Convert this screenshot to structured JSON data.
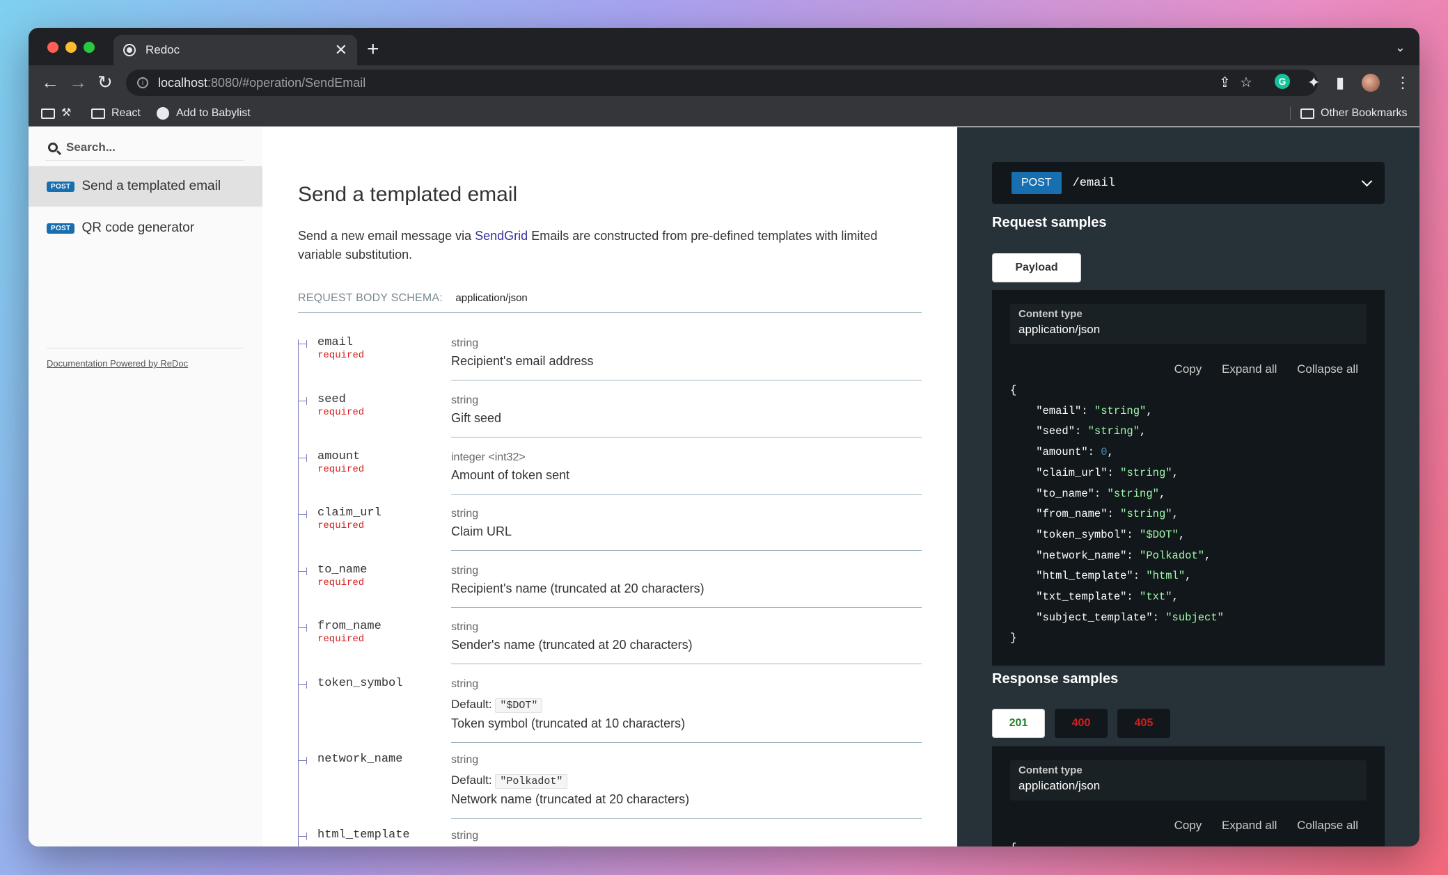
{
  "browser": {
    "tab_title": "Redoc",
    "url_host": "localhost",
    "url_path": ":8080/#operation/SendEmail",
    "bookmarks": [
      "React",
      "Add to Babylist"
    ],
    "other_bookmarks": "Other Bookmarks",
    "extension_g": "G"
  },
  "sidebar": {
    "search_placeholder": "Search...",
    "items": [
      {
        "badge": "POST",
        "label": "Send a templated email"
      },
      {
        "badge": "POST",
        "label": "QR code generator"
      }
    ],
    "powered_by": "Documentation Powered by ReDoc"
  },
  "main": {
    "title": "Send a templated email",
    "desc_prefix": "Send a new email message via ",
    "desc_link": "SendGrid",
    "desc_suffix": " Emails are constructed from pre-defined templates with limited variable substitution.",
    "schema_label": "REQUEST BODY SCHEMA:",
    "schema_content_type": "application/json",
    "props": [
      {
        "name": "email",
        "required": "required",
        "type": "string",
        "desc": "Recipient's email address"
      },
      {
        "name": "seed",
        "required": "required",
        "type": "string",
        "desc": "Gift seed"
      },
      {
        "name": "amount",
        "required": "required",
        "type": "integer <int32>",
        "desc": "Amount of token sent"
      },
      {
        "name": "claim_url",
        "required": "required",
        "type": "string",
        "desc": "Claim URL"
      },
      {
        "name": "to_name",
        "required": "required",
        "type": "string",
        "desc": "Recipient's name (truncated at 20 characters)"
      },
      {
        "name": "from_name",
        "required": "required",
        "type": "string",
        "desc": "Sender's name (truncated at 20 characters)"
      },
      {
        "name": "token_symbol",
        "type": "string",
        "default_label": "Default:",
        "default": "\"$DOT\"",
        "desc": "Token symbol (truncated at 10 characters)"
      },
      {
        "name": "network_name",
        "type": "string",
        "default_label": "Default:",
        "default": "\"Polkadot\"",
        "desc": "Network name (truncated at 20 characters)"
      },
      {
        "name": "html_template",
        "type": "string"
      }
    ]
  },
  "right": {
    "method": "POST",
    "path": "/email",
    "request_samples": "Request samples",
    "payload_tab": "Payload",
    "content_type_label": "Content type",
    "content_type": "application/json",
    "copy": "Copy",
    "expand_all": "Expand all",
    "collapse_all": "Collapse all",
    "json_open": "{",
    "json_close": "}",
    "json_lines": [
      {
        "k": "\"email\"",
        "v": "\"string\"",
        "t": "s",
        "c": ","
      },
      {
        "k": "\"seed\"",
        "v": "\"string\"",
        "t": "s",
        "c": ","
      },
      {
        "k": "\"amount\"",
        "v": "0",
        "t": "n",
        "c": ","
      },
      {
        "k": "\"claim_url\"",
        "v": "\"string\"",
        "t": "s",
        "c": ","
      },
      {
        "k": "\"to_name\"",
        "v": "\"string\"",
        "t": "s",
        "c": ","
      },
      {
        "k": "\"from_name\"",
        "v": "\"string\"",
        "t": "s",
        "c": ","
      },
      {
        "k": "\"token_symbol\"",
        "v": "\"$DOT\"",
        "t": "s",
        "c": ","
      },
      {
        "k": "\"network_name\"",
        "v": "\"Polkadot\"",
        "t": "s",
        "c": ","
      },
      {
        "k": "\"html_template\"",
        "v": "\"html\"",
        "t": "s",
        "c": ","
      },
      {
        "k": "\"txt_template\"",
        "v": "\"txt\"",
        "t": "s",
        "c": ","
      },
      {
        "k": "\"subject_template\"",
        "v": "\"subject\"",
        "t": "s",
        "c": ""
      }
    ],
    "response_samples": "Response samples",
    "response_codes": [
      "201",
      "400",
      "405"
    ],
    "response_content_type_label": "Content type",
    "response_content_type": "application/json",
    "response_json_open": "{"
  }
}
